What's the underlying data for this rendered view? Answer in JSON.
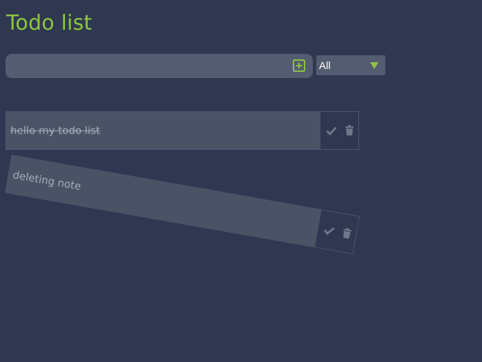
{
  "page": {
    "title": "Todo list"
  },
  "add_form": {
    "input_value": "",
    "input_placeholder": "",
    "add_icon": "plus-square-icon"
  },
  "filter": {
    "selected": "All",
    "caret_icon": "caret-down-icon"
  },
  "todos": [
    {
      "text": "hello my todo list",
      "completed": true,
      "deleting": false
    },
    {
      "text": "deleting note",
      "completed": false,
      "deleting": true
    }
  ],
  "icons": {
    "complete": "check-icon",
    "delete": "trash-icon"
  },
  "colors": {
    "background": "#2f3850",
    "accent": "#8cc63f",
    "input_background": "#535c70",
    "todo_background": "#4a5266",
    "muted_text": "#a6acb8",
    "icon_color": "#6f7789"
  }
}
